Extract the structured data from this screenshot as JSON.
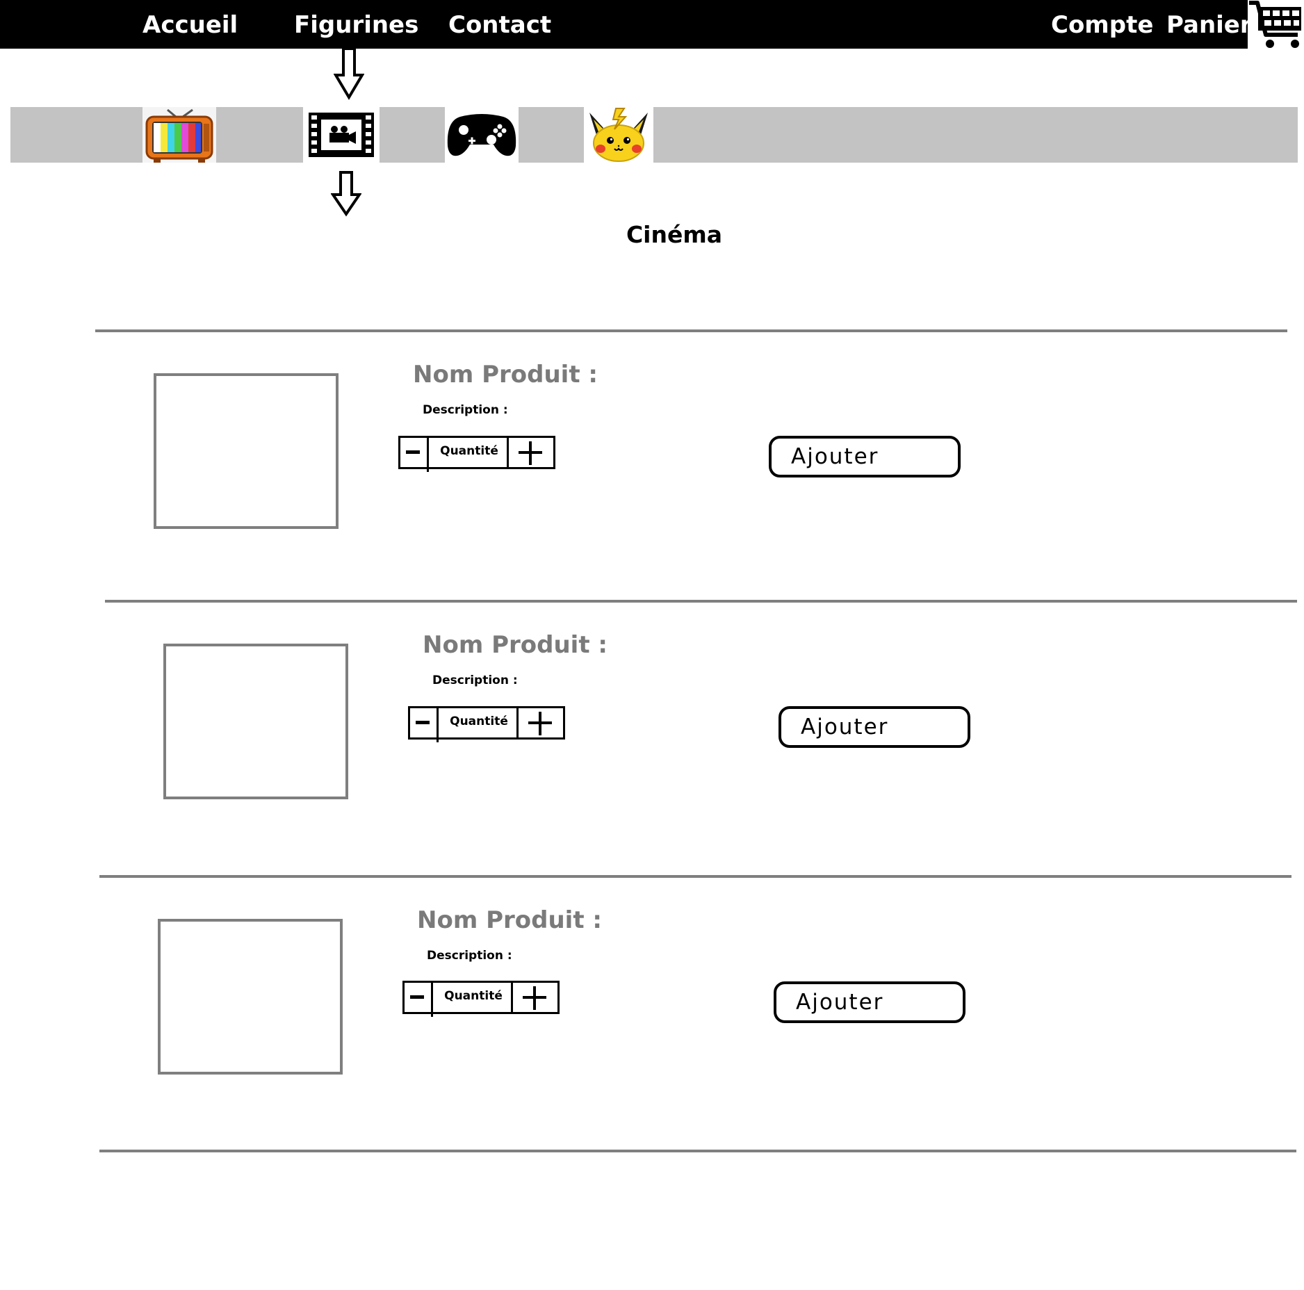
{
  "nav": {
    "home": "Accueil",
    "figurines": "Figurines",
    "contact": "Contact",
    "account": "Compte",
    "cart": "Panier"
  },
  "categories": [
    {
      "icon": "tv-icon"
    },
    {
      "icon": "film-camera-icon"
    },
    {
      "icon": "gamepad-icon"
    },
    {
      "icon": "pikachu-icon"
    }
  ],
  "page_title": "Cinéma",
  "products": [
    {
      "name": "Nom Produit :",
      "description": "Description :",
      "quantity_label": "Quantité",
      "add_label": "Ajouter"
    },
    {
      "name": "Nom Produit :",
      "description": "Description :",
      "quantity_label": "Quantité",
      "add_label": "Ajouter"
    },
    {
      "name": "Nom Produit :",
      "description": "Description :",
      "quantity_label": "Quantité",
      "add_label": "Ajouter"
    }
  ]
}
